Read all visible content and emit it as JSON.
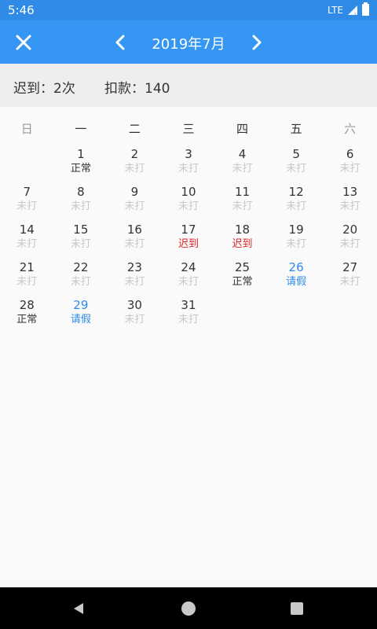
{
  "status_bar": {
    "time": "5:46",
    "network": "LTE"
  },
  "app_bar": {
    "title": "2019年7月"
  },
  "summary": {
    "late": "迟到：2次",
    "deduction": "扣款：140"
  },
  "weekdays": [
    "日",
    "一",
    "二",
    "三",
    "四",
    "五",
    "六"
  ],
  "days": [
    {
      "day": "",
      "status": "",
      "type": "empty"
    },
    {
      "day": "1",
      "status": "正常",
      "type": "normal"
    },
    {
      "day": "2",
      "status": "未打",
      "type": "missed"
    },
    {
      "day": "3",
      "status": "未打",
      "type": "missed"
    },
    {
      "day": "4",
      "status": "未打",
      "type": "missed"
    },
    {
      "day": "5",
      "status": "未打",
      "type": "missed"
    },
    {
      "day": "6",
      "status": "未打",
      "type": "missed"
    },
    {
      "day": "7",
      "status": "未打",
      "type": "missed"
    },
    {
      "day": "8",
      "status": "未打",
      "type": "missed"
    },
    {
      "day": "9",
      "status": "未打",
      "type": "missed"
    },
    {
      "day": "10",
      "status": "未打",
      "type": "missed"
    },
    {
      "day": "11",
      "status": "未打",
      "type": "missed"
    },
    {
      "day": "12",
      "status": "未打",
      "type": "missed"
    },
    {
      "day": "13",
      "status": "未打",
      "type": "missed"
    },
    {
      "day": "14",
      "status": "未打",
      "type": "missed"
    },
    {
      "day": "15",
      "status": "未打",
      "type": "missed"
    },
    {
      "day": "16",
      "status": "未打",
      "type": "missed"
    },
    {
      "day": "17",
      "status": "迟到",
      "type": "late"
    },
    {
      "day": "18",
      "status": "迟到",
      "type": "late"
    },
    {
      "day": "19",
      "status": "未打",
      "type": "missed"
    },
    {
      "day": "20",
      "status": "未打",
      "type": "missed"
    },
    {
      "day": "21",
      "status": "未打",
      "type": "missed"
    },
    {
      "day": "22",
      "status": "未打",
      "type": "missed"
    },
    {
      "day": "23",
      "status": "未打",
      "type": "missed"
    },
    {
      "day": "24",
      "status": "未打",
      "type": "missed"
    },
    {
      "day": "25",
      "status": "正常",
      "type": "normal"
    },
    {
      "day": "26",
      "status": "请假",
      "type": "leave"
    },
    {
      "day": "27",
      "status": "未打",
      "type": "missed"
    },
    {
      "day": "28",
      "status": "正常",
      "type": "normal"
    },
    {
      "day": "29",
      "status": "请假",
      "type": "leave"
    },
    {
      "day": "30",
      "status": "未打",
      "type": "missed"
    },
    {
      "day": "31",
      "status": "未打",
      "type": "missed"
    }
  ],
  "colors": {
    "primary": "#3596f3",
    "late": "#e02424",
    "leave": "#2f8be6",
    "missed": "#c8c8c8"
  },
  "icons": {
    "close": "close-icon",
    "prev": "chevron-left-icon",
    "next": "chevron-right-icon",
    "back": "back-triangle-icon",
    "home": "home-circle-icon",
    "recent": "recent-square-icon"
  }
}
